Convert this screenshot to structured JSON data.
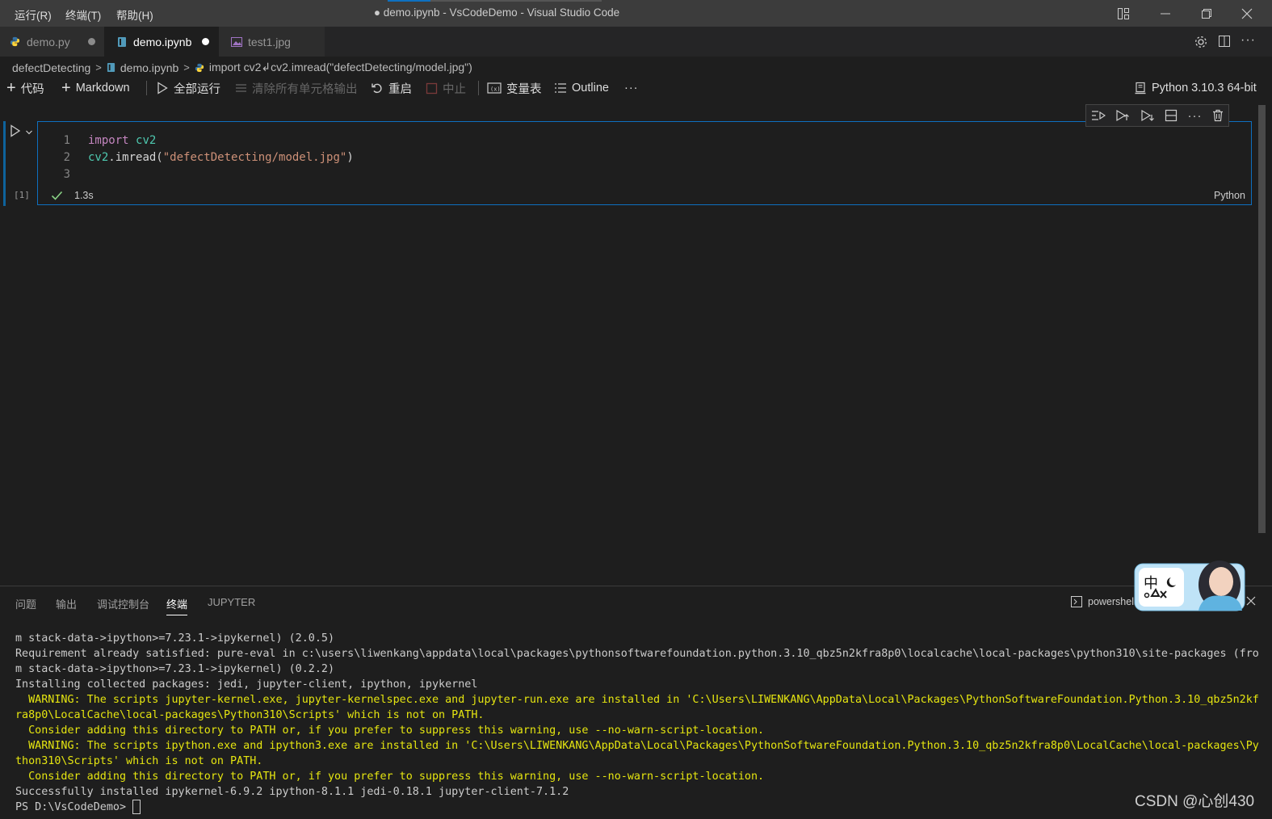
{
  "menu": {
    "items": [
      "运行(R)",
      "终端(T)",
      "帮助(H)"
    ]
  },
  "window": {
    "title": "● demo.ipynb - VsCodeDemo - Visual Studio Code",
    "progress_fraction": 0.2
  },
  "tabs": [
    {
      "label": "demo.py",
      "icon": "python-file-icon",
      "active": false,
      "modified": true
    },
    {
      "label": "demo.ipynb",
      "icon": "notebook-file-icon",
      "active": true,
      "modified": true
    },
    {
      "label": "test1.jpg",
      "icon": "image-file-icon",
      "active": false,
      "modified": false
    }
  ],
  "breadcrumb": {
    "items": [
      "defectDetecting",
      "demo.ipynb",
      "import cv2↲cv2.imread(\"defectDetecting/model.jpg\")"
    ],
    "separator": ">"
  },
  "notebook_toolbar": {
    "add_code": "代码",
    "add_markdown": "Markdown",
    "run_all": "全部运行",
    "clear_outputs": "清除所有单元格输出",
    "restart": "重启",
    "interrupt": "中止",
    "variables": "变量表",
    "outline": "Outline",
    "more": "···",
    "kernel": "Python 3.10.3 64-bit"
  },
  "cell": {
    "execution_count": "[1]",
    "duration": "1.3s",
    "language": "Python",
    "lines": [
      {
        "num": "1",
        "tokens": [
          {
            "t": "import",
            "c": "kw"
          },
          {
            "t": " ",
            "c": "plain"
          },
          {
            "t": "cv2",
            "c": "mod"
          }
        ]
      },
      {
        "num": "2",
        "tokens": [
          {
            "t": "cv2",
            "c": "mod"
          },
          {
            "t": ".imread(",
            "c": "plain"
          },
          {
            "t": "\"defectDetecting/model.jpg\"",
            "c": "str"
          },
          {
            "t": ")",
            "c": "plain"
          }
        ]
      },
      {
        "num": "3",
        "tokens": []
      }
    ]
  },
  "panel": {
    "tabs": [
      "问题",
      "输出",
      "调试控制台",
      "终端",
      "JUPYTER"
    ],
    "active_tab": "终端",
    "terminal_name": "powershell",
    "terminal_lines": [
      {
        "text": "m stack-data->ipython>=7.23.1->ipykernel) (2.0.5)",
        "warn": false
      },
      {
        "text": "Requirement already satisfied: pure-eval in c:\\users\\liwenkang\\appdata\\local\\packages\\pythonsoftwarefoundation.python.3.10_qbz5n2kfra8p0\\localcache\\local-packages\\python310\\site-packages (fro",
        "warn": false
      },
      {
        "text": "m stack-data->ipython>=7.23.1->ipykernel) (0.2.2)",
        "warn": false
      },
      {
        "text": "Installing collected packages: jedi, jupyter-client, ipython, ipykernel",
        "warn": false
      },
      {
        "text": "  WARNING: The scripts jupyter-kernel.exe, jupyter-kernelspec.exe and jupyter-run.exe are installed in 'C:\\Users\\LIWENKANG\\AppData\\Local\\Packages\\PythonSoftwareFoundation.Python.3.10_qbz5n2kf",
        "warn": true
      },
      {
        "text": "ra8p0\\LocalCache\\local-packages\\Python310\\Scripts' which is not on PATH.",
        "warn": true
      },
      {
        "text": "  Consider adding this directory to PATH or, if you prefer to suppress this warning, use --no-warn-script-location.",
        "warn": true
      },
      {
        "text": "  WARNING: The scripts ipython.exe and ipython3.exe are installed in 'C:\\Users\\LIWENKANG\\AppData\\Local\\Packages\\PythonSoftwareFoundation.Python.3.10_qbz5n2kfra8p0\\LocalCache\\local-packages\\Py",
        "warn": true
      },
      {
        "text": "thon310\\Scripts' which is not on PATH.",
        "warn": true
      },
      {
        "text": "  Consider adding this directory to PATH or, if you prefer to suppress this warning, use --no-warn-script-location.",
        "warn": true
      },
      {
        "text": "Successfully installed ipykernel-6.9.2 ipython-8.1.1 jedi-0.18.1 jupyter-client-7.1.2",
        "warn": false
      },
      {
        "text": "PS D:\\VsCodeDemo> ",
        "warn": false,
        "prompt": true
      }
    ]
  },
  "ime": {
    "label": "中"
  },
  "watermark": "CSDN @心创430",
  "colors": {
    "accent": "#0e70c0",
    "warning": "#e5e510",
    "success": "#89d185",
    "python": "#3572a5"
  }
}
